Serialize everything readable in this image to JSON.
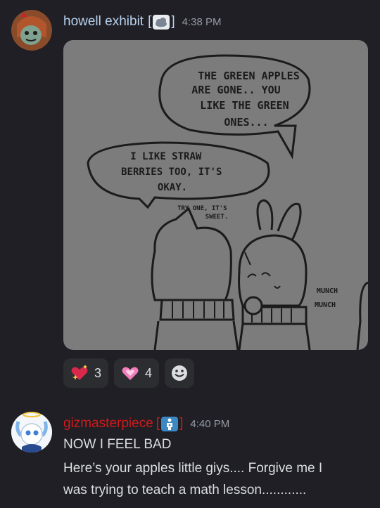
{
  "messages": [
    {
      "username": "howell exhibit",
      "username_color": "#b9d2ee",
      "tag_open": "[",
      "tag_icon": "cloud-icon",
      "tag_close": "]",
      "timestamp": "4:38 PM",
      "attachment": {
        "panel_text": {
          "bubble1": [
            "THE GREEN APPLES",
            "ARE GONE.. YOU",
            "LIKE THE GREEN",
            "ONES..."
          ],
          "bubble2": [
            "I LIKE STRAW",
            "BERRIES TOO, IT'S",
            "OKAY."
          ],
          "small_text": [
            "TRY ONE, IT'S",
            "SWEET."
          ],
          "sfx": [
            "MUNCH",
            "MUNCH"
          ]
        }
      },
      "reactions": [
        {
          "emoji": "sparkling-red-heart-icon",
          "count": "3"
        },
        {
          "emoji": "pink-heart-icon",
          "count": "4"
        }
      ],
      "add_reaction": "smiley-add-reaction-icon"
    },
    {
      "username": "gizmasterpiece",
      "username_color": "#d11a1a",
      "tag_open": "[",
      "tag_icon": "baby-symbol-icon",
      "tag_close": "]",
      "timestamp": "4:40 PM",
      "lines": [
        "NOW I FEEL BAD",
        "Here’s your apples little giys.... Forgive me I",
        "was trying to teach a math lesson............"
      ]
    }
  ]
}
